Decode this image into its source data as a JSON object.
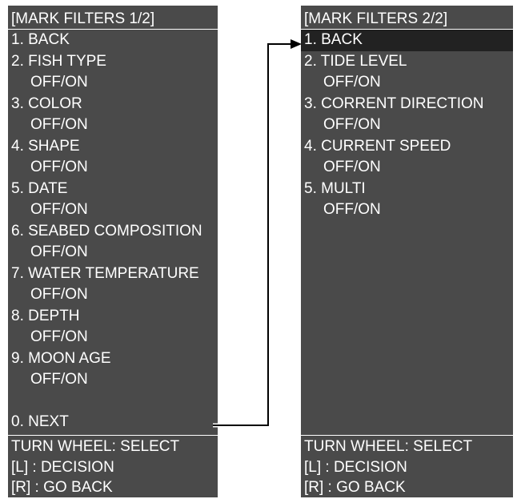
{
  "panel1": {
    "title": "[MARK FILTERS 1/2]",
    "items": [
      {
        "label": "1. BACK"
      },
      {
        "label": "2. FISH TYPE",
        "option": "OFF/ON"
      },
      {
        "label": "3. COLOR",
        "option": "OFF/ON"
      },
      {
        "label": "4. SHAPE",
        "option": "OFF/ON"
      },
      {
        "label": "5. DATE",
        "option": "OFF/ON"
      },
      {
        "label": "6. SEABED COMPOSITION",
        "option": "OFF/ON"
      },
      {
        "label": "7. WATER TEMPERATURE",
        "option": "OFF/ON"
      },
      {
        "label": "8. DEPTH",
        "option": "OFF/ON"
      },
      {
        "label": "9. MOON AGE",
        "option": "OFF/ON"
      }
    ],
    "next": "0. NEXT",
    "footer": [
      "TURN WHEEL: SELECT",
      "[L] : DECISION",
      "[R] : GO BACK"
    ]
  },
  "panel2": {
    "title": "[MARK FILTERS 2/2]",
    "items": [
      {
        "label": "1. BACK"
      },
      {
        "label": "2. TIDE LEVEL",
        "option": "OFF/ON"
      },
      {
        "label": "3. CORRENT DIRECTION",
        "option": "OFF/ON"
      },
      {
        "label": "4. CURRENT SPEED",
        "option": "OFF/ON"
      },
      {
        "label": "5. MULTI",
        "option": "OFF/ON"
      }
    ],
    "footer": [
      "TURN WHEEL: SELECT",
      "[L] : DECISION",
      "[R] : GO BACK"
    ]
  },
  "colors": {
    "panel_background": "#4a4a4a",
    "text": "#ffffff",
    "selected_background": "#222222",
    "connector": "#000000"
  }
}
